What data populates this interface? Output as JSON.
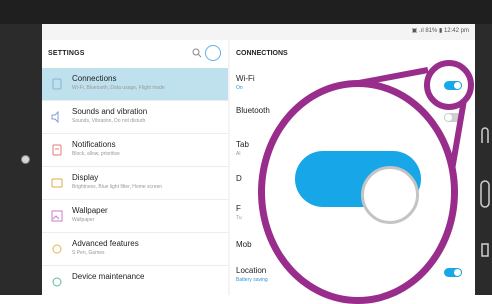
{
  "status_bar": {
    "text": "▣ .ıl 81% ▮ 12:42 pm"
  },
  "left_pane": {
    "title": "SETTINGS",
    "items": [
      {
        "label": "Connections",
        "sub": "Wi-Fi, Bluetooth, Data usage, Flight mode",
        "icon": "connections-icon",
        "active": true
      },
      {
        "label": "Sounds and vibration",
        "sub": "Sounds, Vibration, Do not disturb",
        "icon": "sound-icon"
      },
      {
        "label": "Notifications",
        "sub": "Block, allow, prioritise",
        "icon": "notifications-icon"
      },
      {
        "label": "Display",
        "sub": "Brightness, Blue light filter, Home screen",
        "icon": "display-icon"
      },
      {
        "label": "Wallpaper",
        "sub": "Wallpaper",
        "icon": "wallpaper-icon"
      },
      {
        "label": "Advanced features",
        "sub": "S Pen, Games",
        "icon": "advanced-icon"
      },
      {
        "label": "Device maintenance",
        "sub": "",
        "icon": "maintenance-icon"
      }
    ]
  },
  "right_pane": {
    "title": "CONNECTIONS",
    "items": [
      {
        "label": "Wi-Fi",
        "sub": "On",
        "toggle": "on"
      },
      {
        "label": "Bluetooth",
        "sub": "",
        "toggle": "off"
      },
      {
        "label": "Tab",
        "sub": "Al",
        "toggle": "none"
      },
      {
        "label": "D",
        "sub": "",
        "toggle": "none"
      },
      {
        "label": "F",
        "sub": "Tu",
        "toggle": "none"
      },
      {
        "label": "Mob",
        "sub": "",
        "toggle": "none"
      },
      {
        "label": "Location",
        "sub": "Battery saving",
        "toggle": "on"
      }
    ]
  },
  "colors": {
    "accent": "#17a6e8",
    "highlight": "#992d8c",
    "active_row": "#bfe0ed"
  }
}
